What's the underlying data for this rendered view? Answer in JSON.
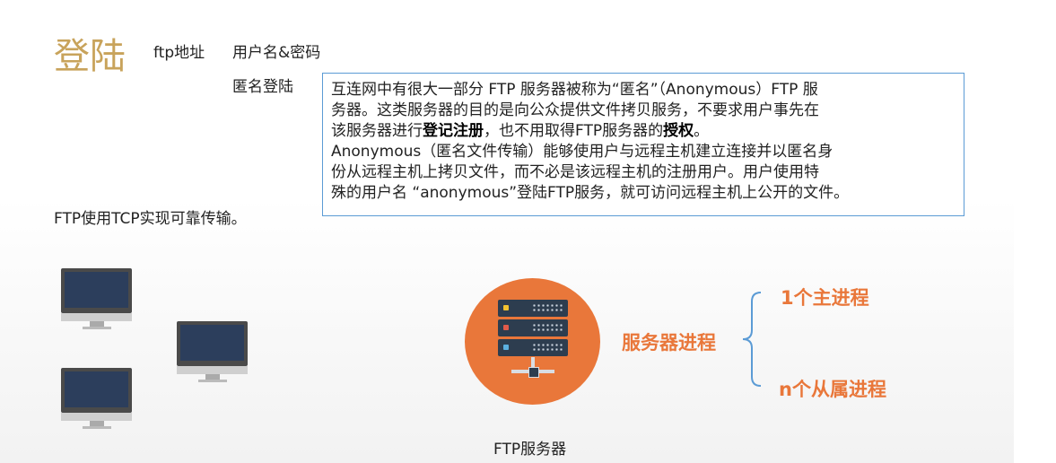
{
  "title": "登陆",
  "header": {
    "ftp_address": "ftp地址",
    "username_password": "用户名&密码",
    "anonymous_login": "匿名登陆"
  },
  "callout": {
    "line1": "互连网中有很大一部分 FTP 服务器被称为“匿名”（Anonymous）FTP 服",
    "line2": "务器。这类服务器的目的是向公众提供文件拷贝服务，不要求用户事先在",
    "line3_pre": "该服务器进行",
    "line3_bold1": "登记注册",
    "line3_mid": "，也不用取得FTP服务器的",
    "line3_bold2": "授权",
    "line3_post": "。",
    "line4": "Anonymous（匿名文件传输）能够使用户与远程主机建立连接并以匿名身",
    "line5": "份从远程主机上拷贝文件，而不必是该远程主机的注册用户。用户使用特",
    "line6": "殊的用户名 “anonymous”登陆FTP服务，就可访问远程主机上公开的文件。"
  },
  "tcp_note": "FTP使用TCP实现可靠传输。",
  "server": {
    "caption": "FTP服务器",
    "process_label": "服务器进程",
    "main_process": "1个主进程",
    "sub_process": "n个从属进程"
  },
  "colors": {
    "title": "#c8a35b",
    "accent": "#e9773a",
    "callout_border": "#5b9bd5"
  },
  "icons": [
    "monitor-icon",
    "server-rack-icon",
    "brace-icon"
  ]
}
